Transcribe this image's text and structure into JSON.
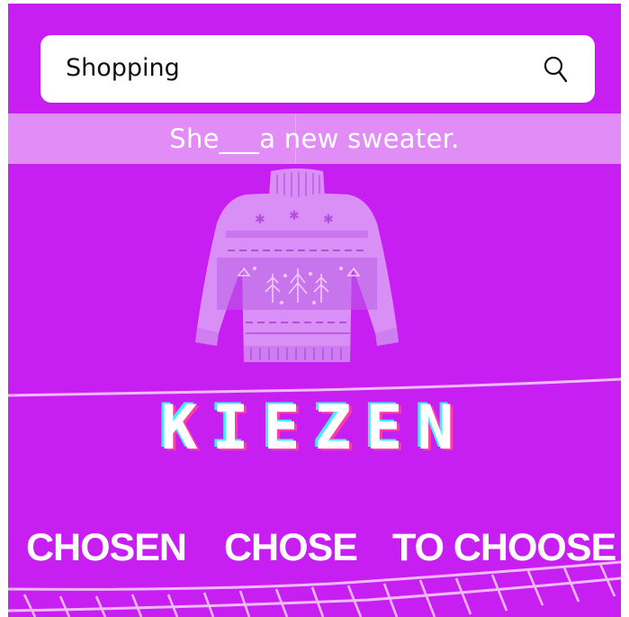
{
  "search": {
    "value": "Shopping",
    "icon": "search-icon"
  },
  "question": {
    "sentence": "She___a new sweater."
  },
  "illustration": {
    "icon": "sweater-icon"
  },
  "brand": {
    "title": "KIEZEN"
  },
  "options": [
    {
      "label": "CHOSEN"
    },
    {
      "label": "CHOSE"
    },
    {
      "label": "TO CHOOSE"
    }
  ],
  "colors": {
    "background": "#c71ff2",
    "band": "#e18cf7",
    "sweater": "#d98ff5",
    "title_cyan": "#3ef0f6",
    "title_pink": "#ff3ea5"
  }
}
